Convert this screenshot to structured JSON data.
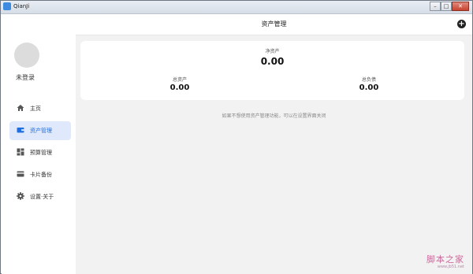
{
  "window": {
    "title": "QianJi",
    "controls": {
      "minimize": "–",
      "maximize": "□",
      "close": "✕"
    }
  },
  "sidebar": {
    "user_name": "未登录",
    "items": [
      {
        "label": "主页",
        "icon": "home-icon",
        "active": false
      },
      {
        "label": "资产管理",
        "icon": "wallet-icon",
        "active": true
      },
      {
        "label": "预算管理",
        "icon": "dashboard-icon",
        "active": false
      },
      {
        "label": "卡片备份",
        "icon": "card-icon",
        "active": false
      },
      {
        "label": "设置·关于",
        "icon": "gear-icon",
        "active": false
      }
    ]
  },
  "header": {
    "title": "资产管理",
    "add_symbol": "+"
  },
  "summary": {
    "net_label": "净资产",
    "net_value": "0.00",
    "total_assets_label": "总资产",
    "total_assets_value": "0.00",
    "total_liabilities_label": "总负债",
    "total_liabilities_value": "0.00"
  },
  "hint": "如果不想使用资产管理功能，可以在设置界面关闭",
  "watermark": {
    "main": "脚本之家",
    "sub": "www.jb51.net"
  },
  "colors": {
    "accent": "#1f6fe0",
    "active_bg": "#dfe9fb",
    "icon": "#555555"
  }
}
